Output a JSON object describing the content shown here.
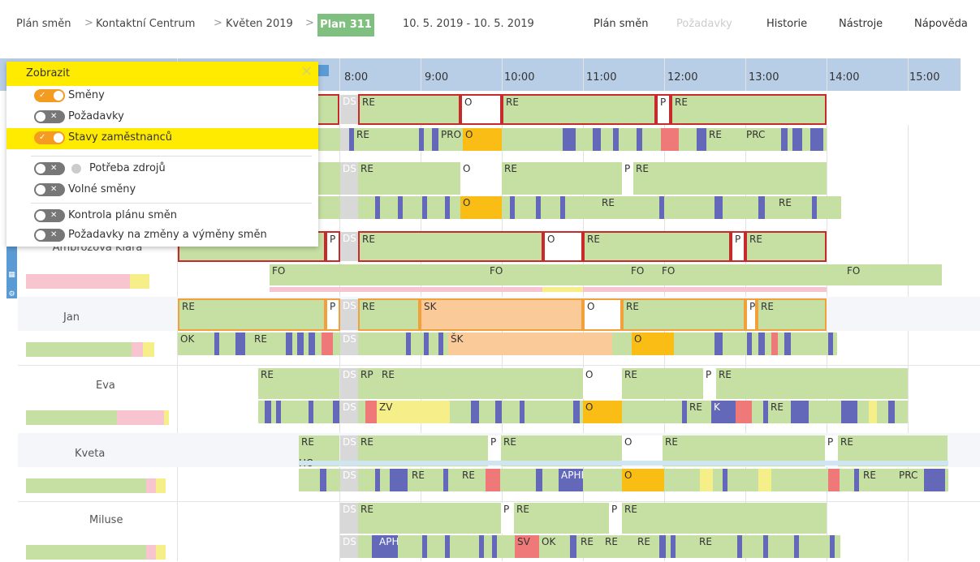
{
  "breadcrumb": [
    "Plán směn",
    "Kontaktní Centrum",
    "Květen 2019"
  ],
  "breadcrumb_sep": ">",
  "plan_badge": "Plan 311",
  "date_range": "10. 5. 2019 - 10. 5. 2019",
  "menu": [
    {
      "label": "Plán směn",
      "disabled": false
    },
    {
      "label": "Požadavky",
      "disabled": true
    },
    {
      "label": "Historie",
      "disabled": false
    },
    {
      "label": "Nástroje",
      "disabled": false
    },
    {
      "label": "Nápověda",
      "disabled": false
    }
  ],
  "hours": [
    "8:00",
    "9:00",
    "10:00",
    "11:00",
    "12:00",
    "13:00",
    "14:00",
    "15:00"
  ],
  "panel": {
    "title": "Zobrazit",
    "close_icon": "close-icon",
    "options": [
      {
        "label": "Směny",
        "on": true,
        "highlight": false
      },
      {
        "label": "Požadavky",
        "on": false,
        "highlight": false
      },
      {
        "label": "Stavy zaměstnanců",
        "on": true,
        "highlight": true
      },
      {
        "label": "Potřeba zdrojů",
        "on": false,
        "highlight": false
      },
      {
        "label": "Volné směny",
        "on": false,
        "highlight": false
      },
      {
        "label": "Kontrola plánu směn",
        "on": false,
        "highlight": false
      },
      {
        "label": "Požadavky na změny a výměny směn",
        "on": false,
        "highlight": false
      }
    ]
  },
  "employees": [
    {
      "name": "Ambrožová Klára"
    },
    {
      "name": "Jan"
    },
    {
      "name": "Eva"
    },
    {
      "name": "Kveta"
    },
    {
      "name": "Miluse"
    }
  ],
  "labels": {
    "DS": "DS",
    "RE": "RE",
    "O": "O",
    "P": "P",
    "PRO": "PRO",
    "PRC": "PRC",
    "FO": "FO",
    "SK": "SK",
    "SK2": "ŠK",
    "OK": "OK",
    "RP": "RP",
    "ZV": "ZV",
    "K": "K",
    "HO": "HO",
    "APH": "APH",
    "APHRE": "APHRE",
    "SV": "SV"
  },
  "colors": {
    "accent": "#ffeb00",
    "header": "#b8cde6",
    "badge": "#7fbf7f",
    "shift": "#c6e0a4",
    "absence": "#fbca99",
    "red_border": "#c62a2a",
    "orange_border": "#f2a13a"
  }
}
